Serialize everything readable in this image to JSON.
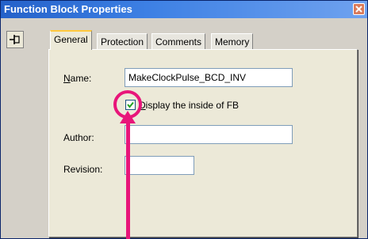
{
  "window": {
    "title": "Function Block Properties"
  },
  "tabs": [
    {
      "label": "General",
      "active": true
    },
    {
      "label": "Protection",
      "active": false
    },
    {
      "label": "Comments",
      "active": false
    },
    {
      "label": "Memory",
      "active": false
    }
  ],
  "general": {
    "name_label_mnemonic": "N",
    "name_label_rest": "ame:",
    "name_value": "MakeClockPulse_BCD_INV",
    "display_inside_mnemonic": "D",
    "display_inside_rest": "isplay the inside of FB",
    "display_inside_checked": true,
    "author_label": "Author:",
    "author_value": "",
    "revision_label": "Revision:",
    "revision_value": ""
  },
  "annotation": {
    "color": "#e8157a"
  },
  "colors": {
    "titlebar": "#2461c9",
    "dialog_bg": "#d4d0c8",
    "active_tab_accent": "#ffc83c"
  },
  "icons": {
    "close": "close-x-icon",
    "pin": "pin-icon",
    "check": "checkmark-icon"
  }
}
